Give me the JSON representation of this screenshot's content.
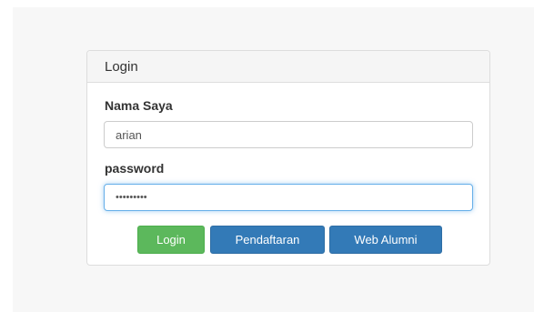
{
  "panel": {
    "title": "Login"
  },
  "form": {
    "name_label": "Nama Saya",
    "name_value": "arian",
    "password_label": "password",
    "password_value": "•••••••••"
  },
  "buttons": {
    "login": "Login",
    "register": "Pendaftaran",
    "alumni": "Web Alumni"
  },
  "colors": {
    "login_button": "#5cb85c",
    "primary_button": "#337ab7",
    "focus_border": "#66afe9"
  }
}
